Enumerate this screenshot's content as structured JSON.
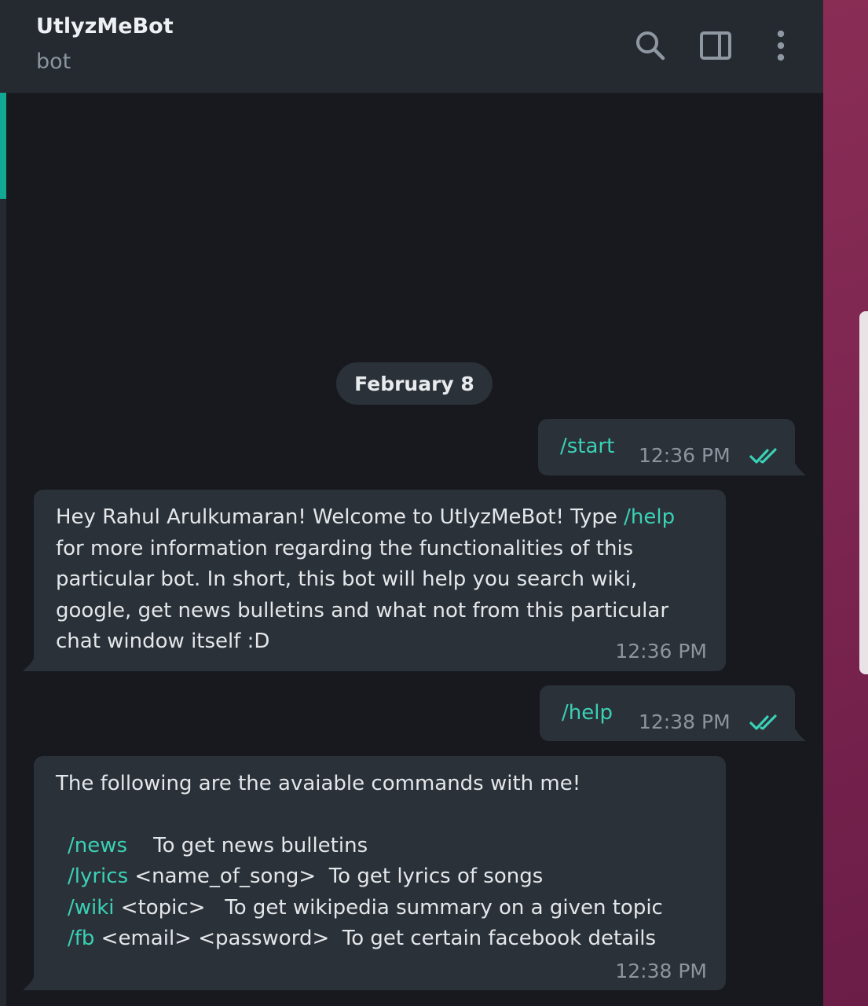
{
  "chat": {
    "title": "UtlyzMeBot",
    "subtitle": "bot"
  },
  "header_icons": [
    "search-icon",
    "sidebar-toggle-icon",
    "more-vertical-icon"
  ],
  "date_separator": "February 8",
  "messages": [
    {
      "direction": "out",
      "text": "/start",
      "time": "12:36 PM",
      "status": "read"
    },
    {
      "direction": "in",
      "lines": [
        {
          "pre": "Hey Rahul Arulkumaran! Welcome to UtlyzMeBot! Type ",
          "cmd": "/help"
        },
        {
          "text": "for more information regarding the functionalities of this"
        },
        {
          "text": "particular bot. In short, this bot will help you search wiki,"
        },
        {
          "text": "google, get news bulletins and what not from this particular"
        },
        {
          "text": "chat window itself :D"
        }
      ],
      "time": "12:36 PM"
    },
    {
      "direction": "out",
      "text": "/help",
      "time": "12:38 PM",
      "status": "read"
    },
    {
      "direction": "in",
      "intro": "The following are the avaiable commands with me!",
      "commands": [
        {
          "cmd": "/news",
          "text": "    To get news bulletins"
        },
        {
          "cmd": "/lyrics",
          "text": " <name_of_song>  To get lyrics of songs"
        },
        {
          "cmd": "/wiki",
          "text": " <topic>   To get wikipedia summary on a given topic"
        },
        {
          "cmd": "/fb",
          "text": " <email> <password>  To get certain facebook details"
        }
      ],
      "time": "12:38 PM"
    }
  ],
  "colors": {
    "accent": "#13a893",
    "command": "#3ad1b6",
    "bubble": "#2b3138",
    "background": "#17191e",
    "header": "#252a31"
  }
}
